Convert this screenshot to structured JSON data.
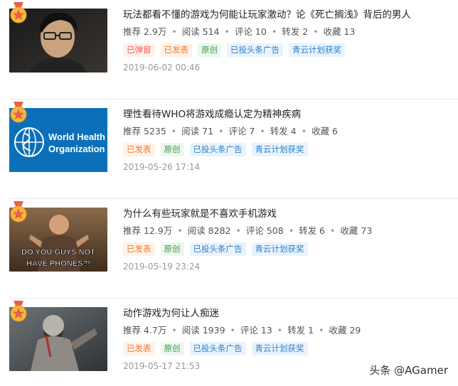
{
  "articles": [
    {
      "title": "玩法都看不懂的游戏为何能让玩家激动？论《死亡搁浅》背后的男人",
      "stats": {
        "recommend": "推荐 2.9万",
        "read": "阅读 514",
        "comment": "评论 10",
        "share": "转发 2",
        "collect": "收藏 13"
      },
      "tags": [
        "已弹窗",
        "已发表",
        "原创",
        "已投头条广告",
        "青云计划获奖"
      ],
      "date": "2019-06-02 00:46"
    },
    {
      "title": "理性看待WHO将游戏成瘾认定为精神疾病",
      "stats": {
        "recommend": "推荐 5235",
        "read": "阅读 71",
        "comment": "评论 7",
        "share": "转发 4",
        "collect": "收藏 6"
      },
      "tags": [
        "已发表",
        "原创",
        "已投头条广告",
        "青云计划获奖"
      ],
      "date": "2019-05-26 17:14",
      "thumb_text": [
        "World Health",
        "Organization"
      ]
    },
    {
      "title": "为什么有些玩家就是不喜欢手机游戏",
      "stats": {
        "recommend": "推荐 12.9万",
        "read": "阅读 8282",
        "comment": "评论 508",
        "share": "转发 6",
        "collect": "收藏 73"
      },
      "tags": [
        "已发表",
        "原创",
        "已投头条广告",
        "青云计划获奖"
      ],
      "date": "2019-05-19 23:24",
      "thumb_text": [
        "DO YOU GUYS NOT",
        "HAVE PHONES?!"
      ]
    },
    {
      "title": "动作游戏为何让人痴迷",
      "stats": {
        "recommend": "推荐 4.7万",
        "read": "阅读 1939",
        "comment": "评论 13",
        "share": "转发 1",
        "collect": "收藏 29"
      },
      "tags": [
        "已发表",
        "原创",
        "已投头条广告",
        "青云计划获奖"
      ],
      "date": "2019-05-17 21:53"
    }
  ],
  "watermark": "头条 @AGamer",
  "colors": {
    "tag_orange": "#f85959",
    "tag_green": "#3a9a4b",
    "tag_blue": "#2a7fc8",
    "date": "#999999"
  }
}
